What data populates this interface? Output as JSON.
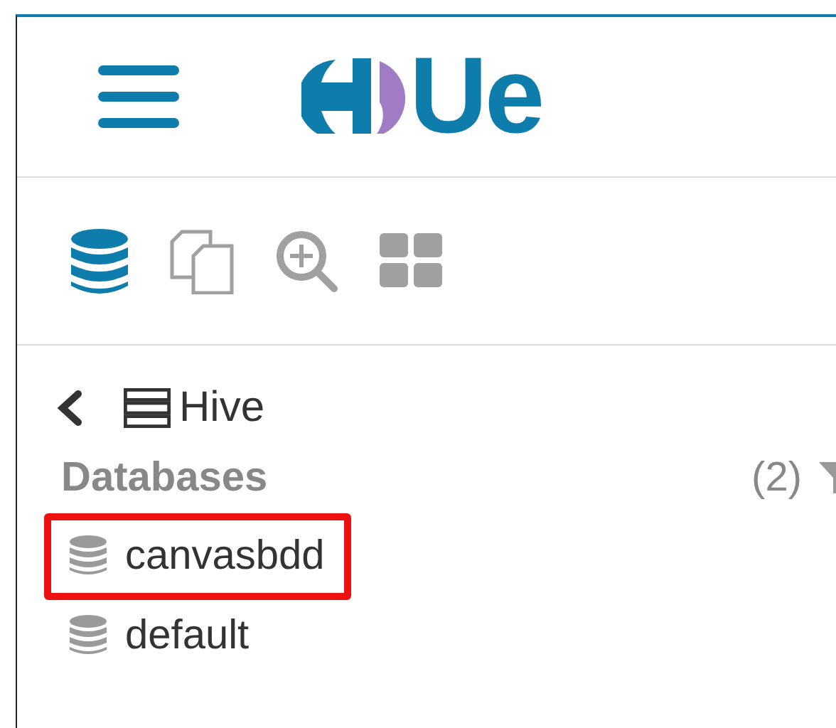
{
  "header": {
    "logo": "Ue"
  },
  "toolbar": [
    {
      "kind": "databases",
      "selected": true
    },
    {
      "kind": "documents",
      "selected": false
    },
    {
      "kind": "search",
      "selected": false
    },
    {
      "kind": "apps",
      "selected": false
    }
  ],
  "breadcrumb": {
    "label": "Hive"
  },
  "section": {
    "title": "Databases",
    "count": "(2)"
  },
  "databases": [
    {
      "name": "canvasbdd",
      "highlighted": true
    },
    {
      "name": "default",
      "highlighted": false
    }
  ]
}
